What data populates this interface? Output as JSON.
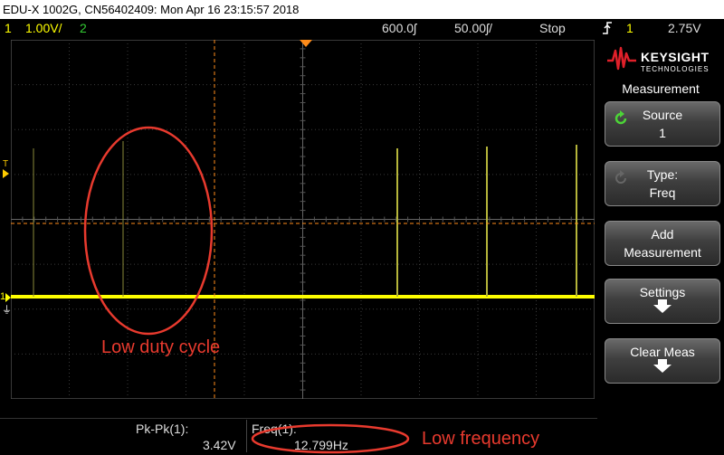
{
  "title_bar": {
    "text": "EDU-X 1002G, CN56402409: Mon Apr 16 23:15:57 2018"
  },
  "status_bar": {
    "ch1_label": "1",
    "ch1_scale": "1.00V/",
    "ch2_label": "2",
    "sample_rate": "600.0ʃ",
    "time_scale": "50.00ʃ/",
    "run_state": "Stop",
    "trigger_icon": "trigger-edge-icon",
    "trigger_source": "1",
    "trigger_level": "2.75V"
  },
  "softkeys": {
    "brand": "KEYSIGHT",
    "brand_sub": "TECHNOLOGIES",
    "menu_title": "Measurement",
    "source": {
      "l1": "Source",
      "l2": "1"
    },
    "type": {
      "l1": "Type:",
      "l2": "Freq"
    },
    "add": {
      "l1": "Add",
      "l2": "Measurement"
    },
    "settings": {
      "l1": "Settings"
    },
    "clear": {
      "l1": "Clear Meas"
    }
  },
  "measurements": {
    "pkpk_label": "Pk-Pk(1):",
    "pkpk_value": "3.42V",
    "freq_label": "Freq(1):",
    "freq_value": "12.799Hz"
  },
  "annotations": {
    "duty": "Low duty cycle",
    "freq": "Low frequency"
  },
  "colors": {
    "channel1": "#ffff00",
    "channel2": "#33cc33",
    "cursor": "#ff8c1a",
    "annotation": "#e83a2e",
    "trigger_marker": "#ff8c1a"
  }
}
